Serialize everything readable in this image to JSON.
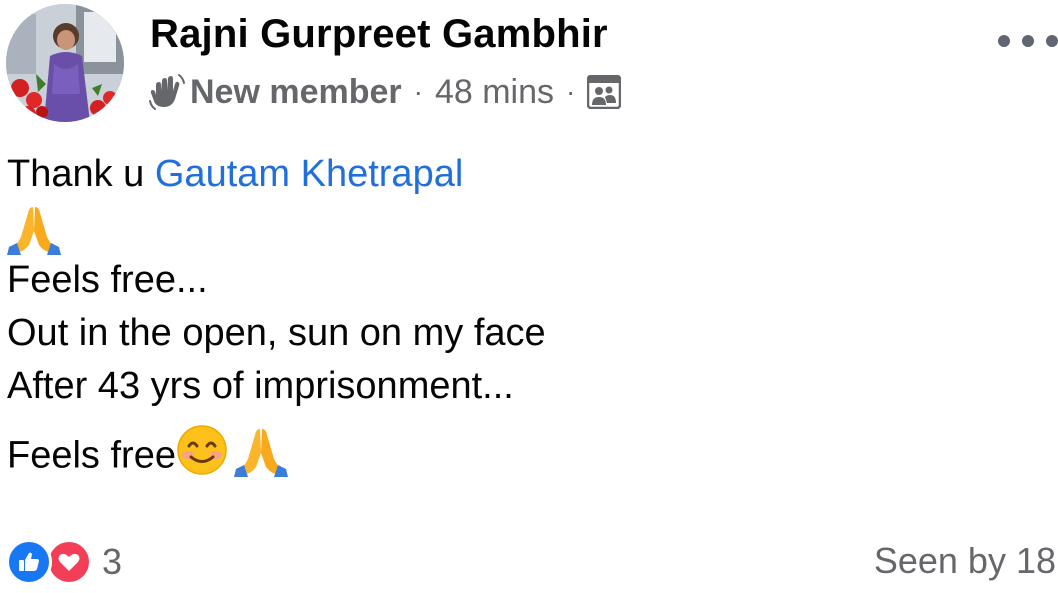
{
  "post": {
    "author": "Rajni Gurpreet Gambhir",
    "badge_icon": "waving-hand-icon",
    "badge": "New member",
    "separator": "·",
    "time": "48 mins",
    "audience_icon": "group-members-icon",
    "more_icon": "ellipsis-icon",
    "body": {
      "line1_text": "Thank u ",
      "mention": "Gautam Khetrapal",
      "line3": "Feels free...",
      "line4": "Out in the open, sun on my face",
      "line5": "After 43 yrs of imprisonment...",
      "line6": "Feels free"
    },
    "emojis": [
      "folded-hands",
      "smiling-face",
      "folded-hands"
    ],
    "reactions": {
      "icons": [
        "like-icon",
        "love-icon"
      ],
      "count": "3"
    },
    "seen": "Seen by 18"
  },
  "colors": {
    "mention": "#216fdb",
    "secondary_text": "#65676b",
    "like": "#1877f2",
    "love": "#f33e58"
  }
}
